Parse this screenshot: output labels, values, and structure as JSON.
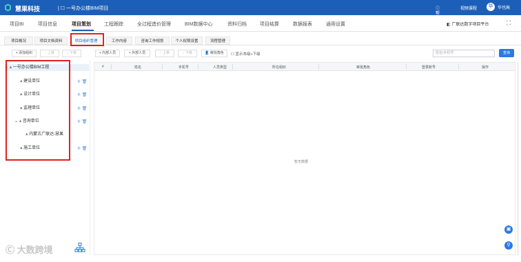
{
  "header": {
    "brand": "慧果科技",
    "project": "一号办公楼BIM项目",
    "help": "帮助",
    "video": "视频课程",
    "user_initial": "华",
    "user_name": "华也高"
  },
  "nav": {
    "items": [
      "项目BI",
      "项目信息",
      "项目策划",
      "工程跟踪",
      "全过程造价管理",
      "BIM数据中心",
      "资料归档",
      "项目结算",
      "数据报表",
      "通用设置"
    ],
    "active_index": 2,
    "platform": "广联达数字项目平台"
  },
  "subtabs": {
    "items": [
      "项目概况",
      "项目文档资料",
      "项目组织管理",
      "工作内容",
      "咨询工作规划",
      "个人权限设置",
      "流程管理"
    ],
    "active_index": 2
  },
  "left_toolbar": {
    "add_org": "添加组织",
    "up": "上移",
    "down": "下移"
  },
  "right_toolbar": {
    "internal": "内部人员",
    "external": "外部人员",
    "up": "上移",
    "down": "下移",
    "role": "审批角色",
    "show_sub": "显示本级+下级",
    "search_placeholder": "姓名/手机号",
    "query": "查询"
  },
  "tree": {
    "root": "一号办公楼BIM工程",
    "nodes": [
      "建设单位",
      "设计单位",
      "监理单位",
      "咨询单位",
      "内蒙古广联达-慧果",
      "施工单位"
    ]
  },
  "table": {
    "columns": [
      "#",
      "姓名",
      "手机号",
      "人员类型",
      "所在组织",
      "审批角色",
      "登录账号",
      "操作"
    ],
    "empty": "暂无数据"
  },
  "watermark": "大数跨境",
  "colors": {
    "primary": "#1c5fb8",
    "highlight": "#e02020"
  }
}
